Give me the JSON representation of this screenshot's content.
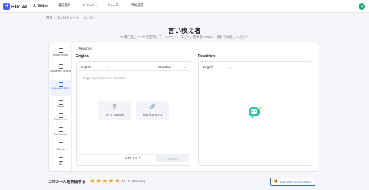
{
  "header": {
    "logo_mark": "H",
    "logo": "HIX.AI",
    "product": "AI Writer",
    "nav": [
      {
        "label": "著記用具"
      },
      {
        "label": "AIツール"
      },
      {
        "label": "リソース"
      },
      {
        "label": "価格設定"
      }
    ],
    "avatar_initial": "A"
  },
  "breadcrumb": {
    "home": "首頁",
    "parent": "言い換えツール",
    "current": "言い換え"
  },
  "page": {
    "title": "言い換え者",
    "subtitle": "AI 書き直しツールを使用して、エッセイ、コピー、記事をReword・無料でお試しください!"
  },
  "sidebar": {
    "items": [
      {
        "label": "Most Popular",
        "icon": "star-icon",
        "active": false
      },
      {
        "label": "Academic Writing",
        "icon": "book-icon",
        "active": false
      },
      {
        "label": "Articles & SEO",
        "icon": "article-icon",
        "active": true
      },
      {
        "label": "Email",
        "icon": "mail-icon",
        "active": false
      },
      {
        "label": "Social & Ad",
        "icon": "social-icon",
        "active": false
      },
      {
        "label": "Ecommerce",
        "icon": "cart-icon",
        "active": false
      },
      {
        "label": "Others",
        "icon": "more-icon",
        "active": false
      },
      {
        "label": "All",
        "icon": "grid-icon",
        "active": false
      }
    ]
  },
  "tool": {
    "back_label": "Reworder",
    "original_label": "Original",
    "rewritten_label": "Rewritten",
    "original_language": "English",
    "style": "Standard",
    "rewritten_language": "English",
    "placeholder": "Copy and paste your text here",
    "try_sample": "Try a Sample",
    "text_from_url": "Text from URL",
    "model": "GPT-3.5",
    "rewrite_button": "Rewrite"
  },
  "footer": {
    "rate_label": "このツールを評価する",
    "rating": 4.8,
    "rating_text": "4.8 / 5 (39 votes)",
    "earn_label": "Earn 30% Commission"
  },
  "colors": {
    "accent": "#3563e9",
    "star": "#f6a623",
    "avatar": "#20a56b",
    "mascot": "#27c9a6"
  }
}
